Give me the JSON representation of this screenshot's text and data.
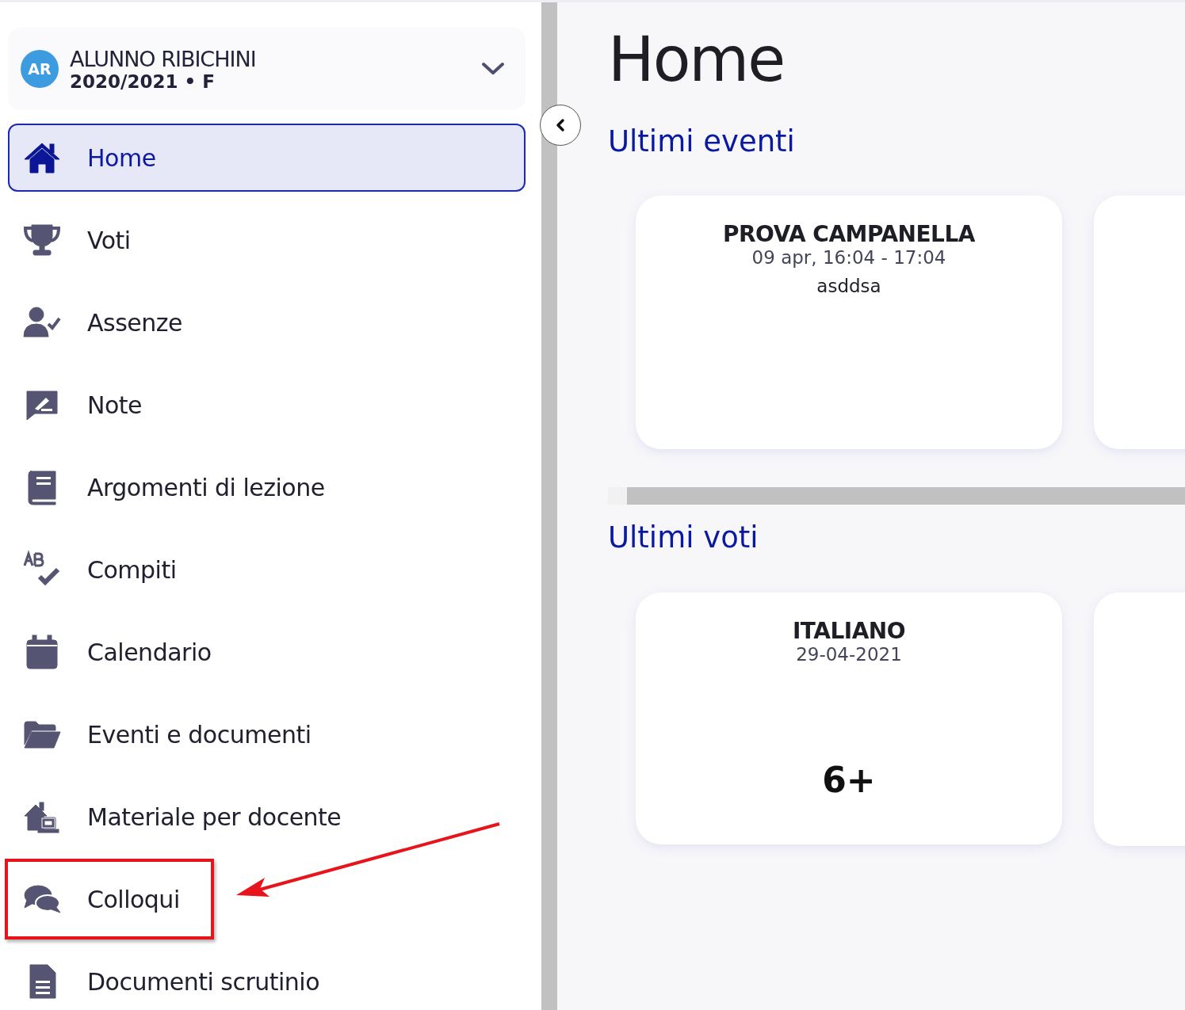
{
  "profile": {
    "initials": "AR",
    "name": "ALUNNO RIBICHINI",
    "subtitle": "2020/2021 • F"
  },
  "sidebar": {
    "items": [
      {
        "label": "Home",
        "selected": true,
        "highlighted": false
      },
      {
        "label": "Voti",
        "selected": false,
        "highlighted": false
      },
      {
        "label": "Assenze",
        "selected": false,
        "highlighted": false
      },
      {
        "label": "Note",
        "selected": false,
        "highlighted": false
      },
      {
        "label": "Argomenti di lezione",
        "selected": false,
        "highlighted": false
      },
      {
        "label": "Compiti",
        "selected": false,
        "highlighted": false
      },
      {
        "label": "Calendario",
        "selected": false,
        "highlighted": false
      },
      {
        "label": "Eventi e documenti",
        "selected": false,
        "highlighted": false
      },
      {
        "label": "Materiale per docente",
        "selected": false,
        "highlighted": false
      },
      {
        "label": "Colloqui",
        "selected": false,
        "highlighted": true
      },
      {
        "label": "Documenti scrutinio",
        "selected": false,
        "highlighted": false
      }
    ]
  },
  "main": {
    "title": "Home",
    "events": {
      "heading": "Ultimi eventi",
      "cards": [
        {
          "title": "PROVA CAMPANELLA",
          "time": "09 apr, 16:04 - 17:04",
          "description": "asddsa"
        }
      ]
    },
    "grades": {
      "heading": "Ultimi voti",
      "cards": [
        {
          "subject": "ITALIANO",
          "date": "29-04-2021",
          "grade": "6+"
        }
      ]
    }
  }
}
